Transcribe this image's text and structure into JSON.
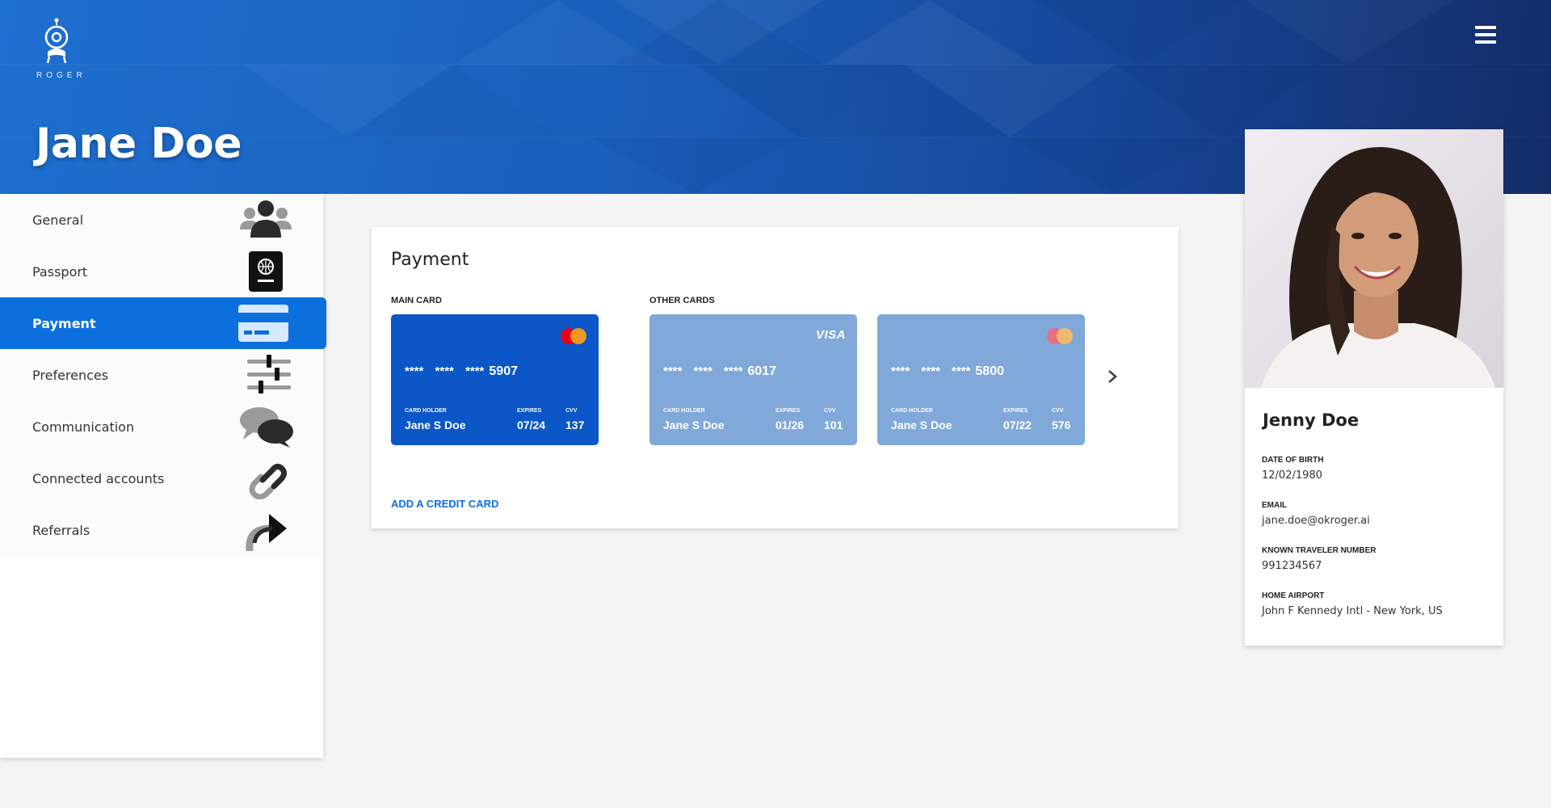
{
  "brand": {
    "logo_text": "ROGER"
  },
  "header": {
    "title": "Jane Doe"
  },
  "sidebar": {
    "items": [
      {
        "label": "General",
        "icon": "users-icon"
      },
      {
        "label": "Passport",
        "icon": "passport-icon"
      },
      {
        "label": "Payment",
        "icon": "credit-card-icon",
        "active": true
      },
      {
        "label": "Preferences",
        "icon": "sliders-icon"
      },
      {
        "label": "Communication",
        "icon": "chat-bubbles-icon"
      },
      {
        "label": "Connected accounts",
        "icon": "link-icon"
      },
      {
        "label": "Referrals",
        "icon": "share-arrow-icon"
      }
    ]
  },
  "payment": {
    "title": "Payment",
    "main_label": "MAIN CARD",
    "other_label": "OTHER CARDS",
    "add_card_label": "ADD A CREDIT CARD",
    "holder_label": "CARD HOLDER",
    "expires_label": "EXPIRES",
    "cvv_label": "CVV",
    "masked": "**** **** ****",
    "cards": [
      {
        "brand": "mastercard",
        "last4": "5907",
        "holder": "Jane S Doe",
        "expires": "07/24",
        "cvv": "137"
      },
      {
        "brand": "VISA",
        "last4": "6017",
        "holder": "Jane S Doe",
        "expires": "01/26",
        "cvv": "101"
      },
      {
        "brand": "mastercard",
        "last4": "5800",
        "holder": "Jane S Doe",
        "expires": "07/22",
        "cvv": "576"
      }
    ]
  },
  "profile": {
    "name": "Jenny Doe",
    "fields": [
      {
        "label": "DATE OF BIRTH",
        "value": "12/02/1980"
      },
      {
        "label": "EMAIL",
        "value": "jane.doe@okroger.ai"
      },
      {
        "label": "KNOWN TRAVELER NUMBER",
        "value": "991234567"
      },
      {
        "label": "HOME AIRPORT",
        "value": "John F Kennedy Intl - New York, US"
      }
    ]
  },
  "colors": {
    "accent": "#0c6fde",
    "main_card": "#0b57c7",
    "other_card": "#80a9d9",
    "banner_start": "#1d6fd0",
    "banner_end": "#142c66"
  }
}
